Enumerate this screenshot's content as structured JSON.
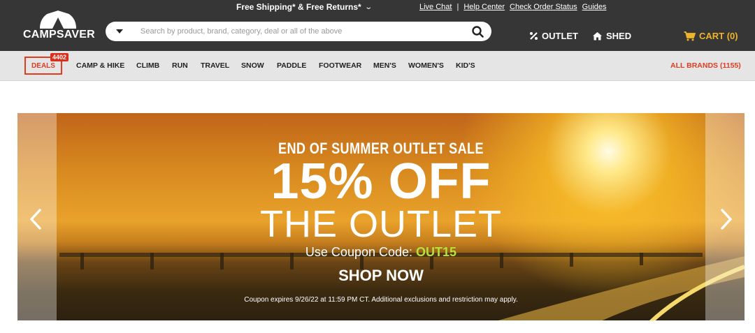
{
  "header": {
    "promo": "Free Shipping* & Free Returns*",
    "links": [
      "Live Chat",
      "Help Center",
      "Check Order Status",
      "Guides"
    ],
    "logo_text": "CAMPSAVER",
    "search": {
      "placeholder": "Search by product, brand, category, deal or all of the above"
    },
    "outlet_label": "OUTLET",
    "shed_label": "SHED",
    "cart_label": "CART (0)",
    "cart_color": "#f0b429"
  },
  "catnav": {
    "deals_label": "DEALS",
    "deals_count": "4402",
    "items": [
      "CAMP & HIKE",
      "CLIMB",
      "RUN",
      "TRAVEL",
      "SNOW",
      "PADDLE",
      "FOOTWEAR",
      "MEN'S",
      "WOMEN'S",
      "KID'S"
    ],
    "all_brands": "ALL BRANDS (1155)",
    "accent": "#e03c1f"
  },
  "hero": {
    "kicker": "END OF SUMMER OUTLET SALE",
    "headline": "15% OFF",
    "subheadline": "THE OUTLET",
    "coupon_prefix": "Use Coupon Code:",
    "coupon_code": "OUT15",
    "cta": "SHOP NOW",
    "fine_print": "Coupon expires 9/26/22 at 11:59 PM CT. Additional exclusions and restriction may apply.",
    "code_color": "#b9e03a"
  },
  "icons": [
    "caret-down-icon",
    "search-icon",
    "outlet-icon",
    "home-icon",
    "cart-icon",
    "chevron-left-icon",
    "chevron-right-icon"
  ]
}
